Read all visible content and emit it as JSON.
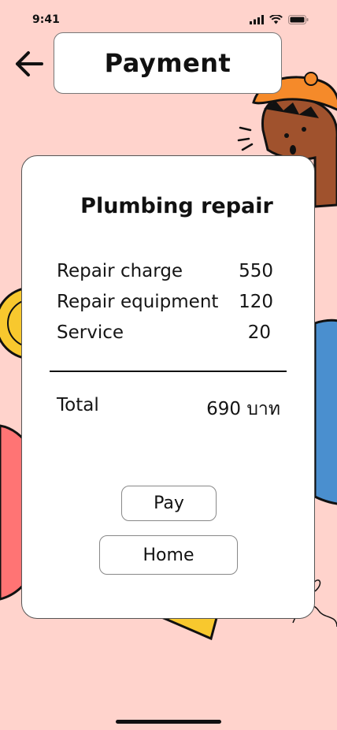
{
  "status_bar": {
    "time": "9:41"
  },
  "header": {
    "title": "Payment",
    "back_icon": "arrow-left-icon"
  },
  "bill": {
    "service": "Plumbing repair",
    "items": [
      {
        "label": "Repair charge",
        "amount": "550"
      },
      {
        "label": "Repair equipment",
        "amount": "120"
      },
      {
        "label": "Service",
        "amount": "20"
      }
    ],
    "total_label": "Total",
    "total_value": "690 บาท"
  },
  "actions": {
    "pay_label": "Pay",
    "home_label": "Home"
  },
  "colors": {
    "background": "#ffd3cc",
    "card": "#ffffff",
    "hat": "#f58a2a",
    "blue": "#4a8fcf",
    "yellow": "#f8c82e",
    "red": "#ff7474"
  }
}
